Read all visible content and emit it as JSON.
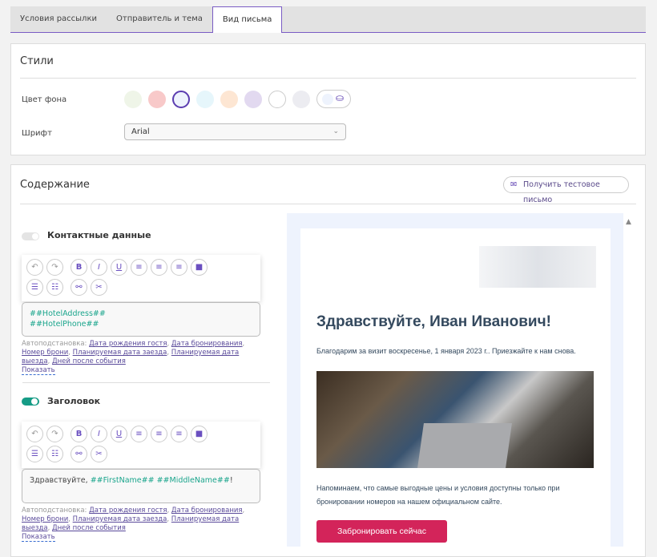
{
  "tabs": [
    {
      "label": "Условия рассылки"
    },
    {
      "label": "Отправитель и тема"
    },
    {
      "label": "Вид письма"
    }
  ],
  "styles": {
    "title": "Стили",
    "bg_label": "Цвет фона",
    "font_label": "Шрифт",
    "font_value": "Arial",
    "swatches": [
      "#eff5e8",
      "#f8c9c9",
      "#eef3fd",
      "#e6f6fb",
      "#fde6d3",
      "#e2d9f0",
      "#ffffff",
      "#ececf1"
    ],
    "selected_index": 2,
    "custom_color": "#eef3fd"
  },
  "content": {
    "title": "Содержание",
    "test_button": "Получить тестовое письмо",
    "contacts": {
      "label": "Контактные данные",
      "enabled": false,
      "line1": "##HotelAddress##",
      "line2": "##HotelPhone##"
    },
    "header": {
      "label": "Заголовок",
      "enabled": true,
      "text_prefix": "Здравствуйте, ",
      "tag1": "##FirstName##",
      "tag2": "##MiddleName##",
      "suffix": "!"
    },
    "autosub": {
      "label": "Автоподстановка:",
      "links": [
        "Дата рождения гостя",
        "Дата бронирования",
        "Номер брони",
        "Планируемая дата заезда",
        "Планируемая дата выезда",
        "Дней после события"
      ],
      "show": "Показать"
    }
  },
  "preview": {
    "heading": "Здравствуйте, Иван Иванович!",
    "thanks": "Благодарим за визит воскресенье, 1 января 2023 г.. Приезжайте к нам снова.",
    "reminder": "Напоминаем, что самые выгодные цены и условия доступны только при бронировании номеров на нашем официальном сайте.",
    "book_button": "Забронировать сейчас",
    "accent": "#d3245a"
  }
}
